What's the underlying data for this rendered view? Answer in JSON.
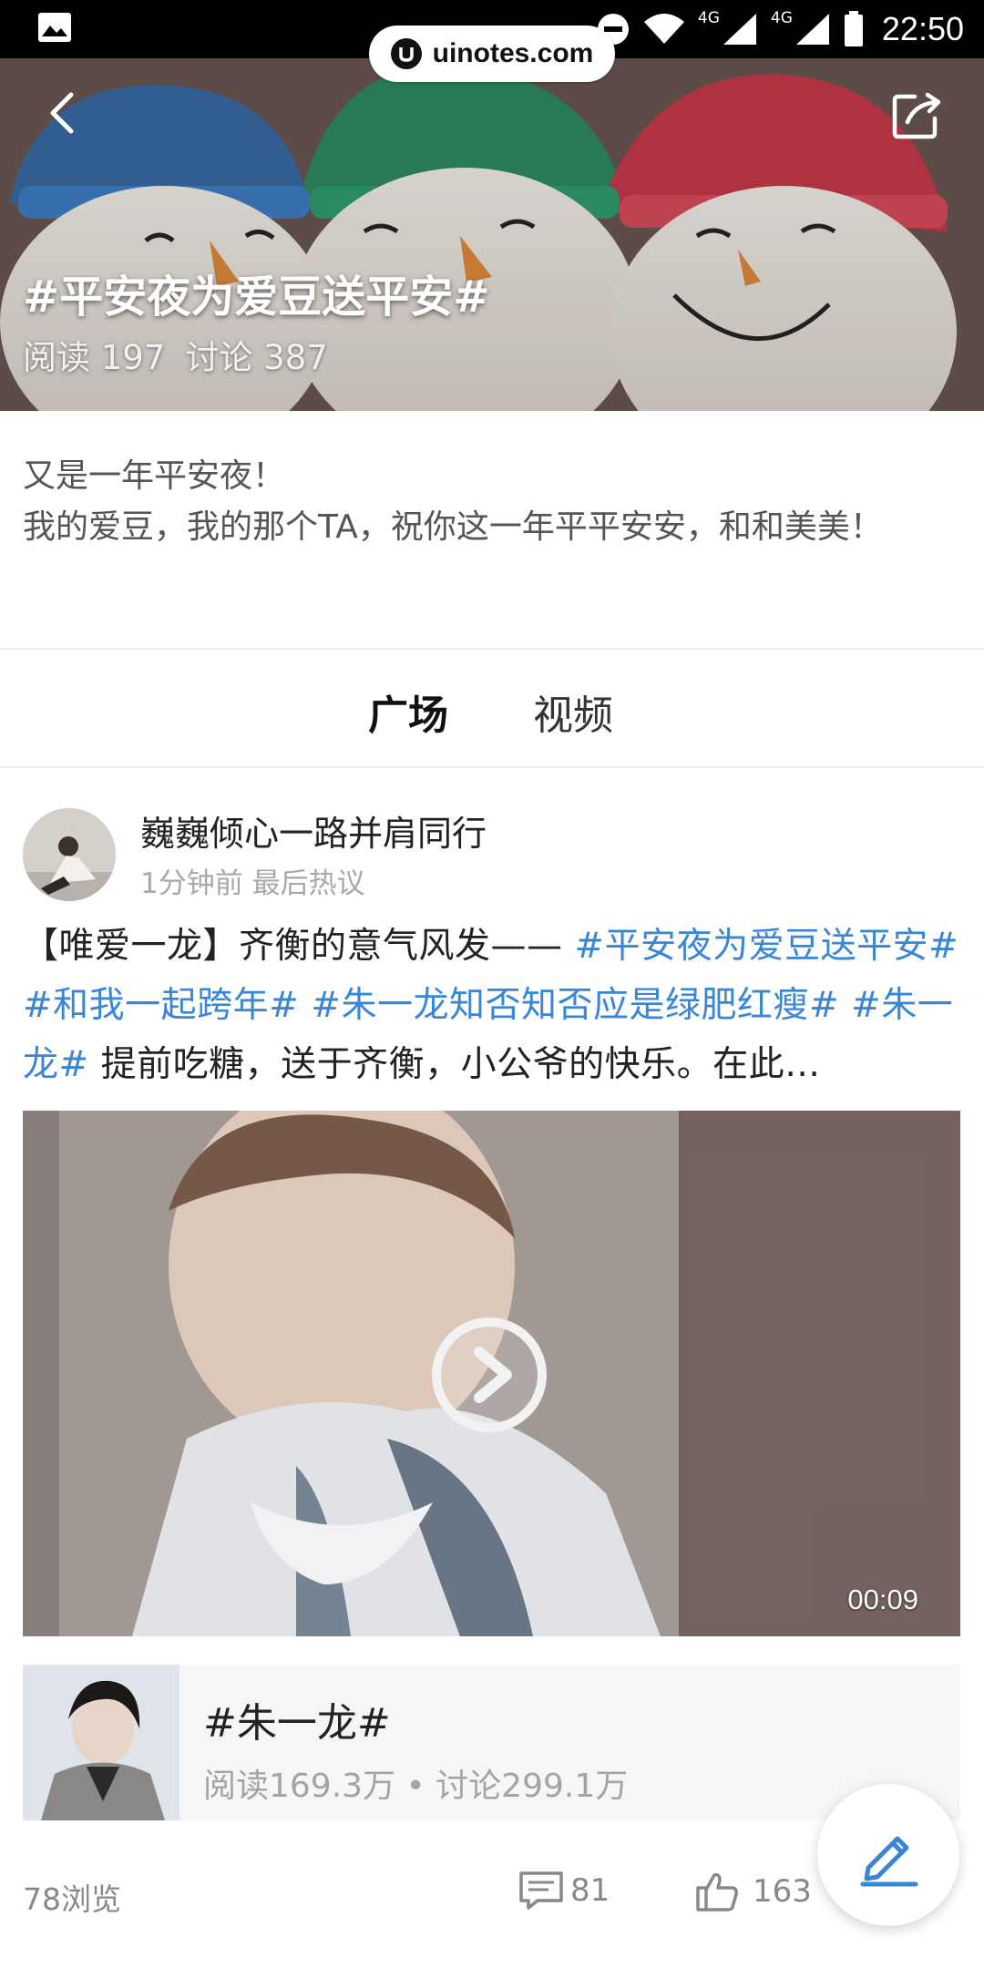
{
  "status_bar": {
    "time": "22:50",
    "network_1": "4G",
    "network_2": "4G"
  },
  "watermark": {
    "text": "uinotes.com"
  },
  "header": {
    "topic_title": "#平安夜为爱豆送平安#",
    "read_stat": "阅读 197",
    "discuss_stat": "讨论 387"
  },
  "description": {
    "line1": "又是一年平安夜！",
    "line2": "我的爱豆，我的那个TA，祝你这一年平平安安，和和美美！"
  },
  "tabs": [
    {
      "label": "广场",
      "active": true
    },
    {
      "label": "视频",
      "active": false
    }
  ],
  "post": {
    "author": "巍巍倾心一路并肩同行",
    "meta": "1分钟前 最后热议",
    "text_prefix": "【唯爱一龙】齐衡的意气风发—— ",
    "hashtags": [
      "#平安夜为爱豆送平安#",
      "#和我一起跨年#",
      "#朱一龙知否知否应是绿肥红瘦#",
      "#朱一龙#"
    ],
    "text_suffix": " 提前吃糖，送于齐衡，小公爷的快乐。在此…",
    "video_duration": "00:09",
    "topic_card": {
      "title": "#朱一龙#",
      "stats": "阅读169.3万 • 讨论299.1万"
    },
    "views": "78浏览",
    "comments": "81",
    "likes": "163"
  },
  "colors": {
    "hashtag": "#3a86d6",
    "fab_icon": "#3a86d6"
  },
  "icons": [
    "gallery-icon",
    "dnd-icon",
    "wifi-icon",
    "signal-icon",
    "battery-icon",
    "back-icon",
    "share-icon",
    "play-icon",
    "comment-icon",
    "like-icon",
    "edit-icon"
  ]
}
